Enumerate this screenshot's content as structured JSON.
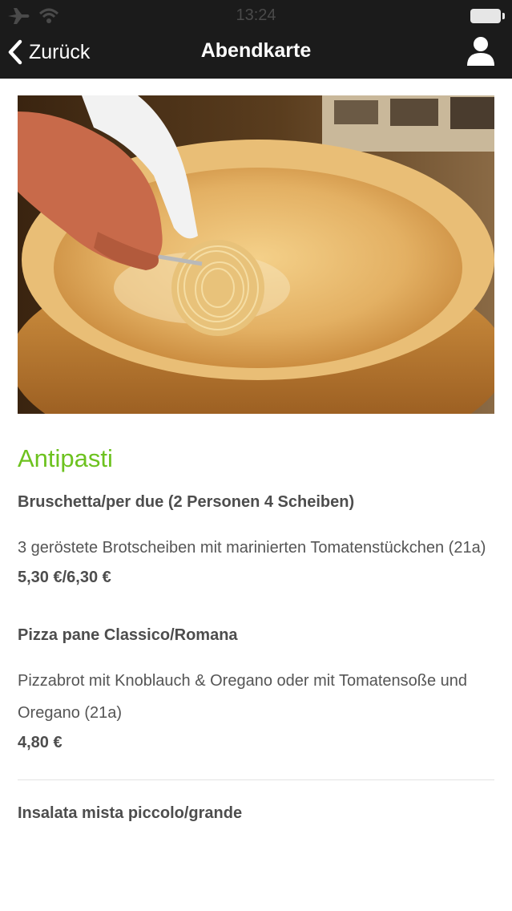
{
  "status_bar": {
    "time": "13:24",
    "icons": [
      "airplane-icon",
      "wifi-icon",
      "battery-icon"
    ]
  },
  "nav": {
    "back_label": "Zurück",
    "title": "Abendkarte",
    "user_icon": "user-icon"
  },
  "colors": {
    "navbar": "#1b1b1b",
    "section_title": "#6dc21f",
    "text": "#4d4d4d"
  },
  "menu": {
    "section": "Antipasti",
    "items": [
      {
        "name": "Bruschetta/per due (2 Personen 4 Scheiben)",
        "description": "3 geröstete Brotscheiben mit marinierten Tomatenstückchen (21a)",
        "price": "5,30 €/6,30 €"
      },
      {
        "name": "Pizza pane Classico/Romana",
        "description": "Pizzabrot mit Knoblauch & Oregano oder mit Tomatensoße und Oregano (21a)",
        "price": "4,80 €"
      },
      {
        "name": "Insalata mista piccolo/grande"
      }
    ]
  }
}
